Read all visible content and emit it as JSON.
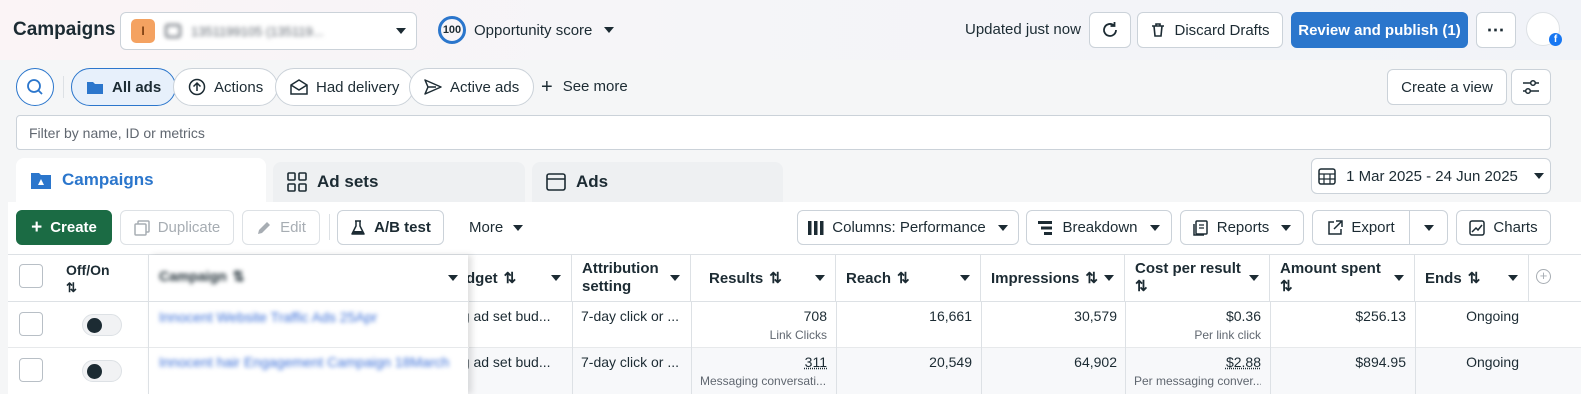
{
  "header": {
    "title": "Campaigns",
    "account_value": "1351199105 (135119...",
    "opportunity_score": "100",
    "opportunity_label": "Opportunity score",
    "updated": "Updated just now",
    "discard": "Discard Drafts",
    "review": "Review and publish (1)"
  },
  "filters": {
    "pills": [
      {
        "label": "All ads",
        "icon": "folder-icon"
      },
      {
        "label": "Actions",
        "icon": "arrow-up-circle-icon"
      },
      {
        "label": "Had delivery",
        "icon": "envelope-icon"
      },
      {
        "label": "Active ads",
        "icon": "send-icon"
      }
    ],
    "see_more": "See more",
    "create_view": "Create a view",
    "search_placeholder": "Filter by name, ID or metrics"
  },
  "tabs": {
    "campaigns": "Campaigns",
    "adsets": "Ad sets",
    "ads": "Ads",
    "date_range": "1 Mar 2025 - 24 Jun 2025"
  },
  "toolbar": {
    "create": "Create",
    "duplicate": "Duplicate",
    "edit": "Edit",
    "ab_test": "A/B test",
    "more": "More",
    "columns": "Columns: Performance",
    "breakdown": "Breakdown",
    "reports": "Reports",
    "export": "Export",
    "charts": "Charts"
  },
  "table": {
    "headers": {
      "offon": "Off/On",
      "campaign": "Campaign",
      "budget": "dget",
      "attribution_1": "Attribution",
      "attribution_2": "setting",
      "results": "Results",
      "reach": "Reach",
      "impressions": "Impressions",
      "cpr": "Cost per result",
      "amount": "Amount spent",
      "ends": "Ends"
    },
    "rows": [
      {
        "campaign": "Innocent Website Traffic Ads 25Apr",
        "budget": "ng ad set bud...",
        "attribution": "7-day click or ...",
        "results": "708",
        "results_sub": "Link Clicks",
        "reach": "16,661",
        "impressions": "30,579",
        "cpr": "$0.36",
        "cpr_sub": "Per link click",
        "amount": "$256.13",
        "ends": "Ongoing"
      },
      {
        "campaign": "Innocent hair Engagement Campaign 18March",
        "budget": "ng ad set bud...",
        "attribution": "7-day click or ...",
        "results": "311",
        "results_sub": "Messaging conversati...",
        "reach": "20,549",
        "impressions": "64,902",
        "cpr": "$2.88",
        "cpr_sub": "Per messaging conver...",
        "amount": "$894.95",
        "ends": "Ongoing"
      }
    ]
  },
  "colors": {
    "primary": "#2b76cc",
    "create_green": "#1b6b44",
    "link_blue": "#3a6fd8"
  }
}
